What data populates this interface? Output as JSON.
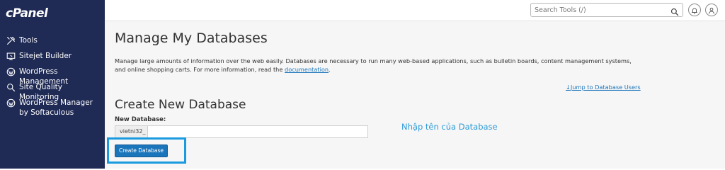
{
  "brand": {
    "logo_text": "cPanel"
  },
  "sidebar": {
    "items": [
      {
        "label": "Tools",
        "icon": "tools-icon"
      },
      {
        "label": "Sitejet Builder",
        "icon": "sitejet-icon"
      },
      {
        "label": "WordPress Management",
        "icon": "wordpress-icon"
      },
      {
        "label": "Site Quality Monitoring",
        "icon": "site-quality-icon"
      },
      {
        "label": "WordPress Manager by Softaculous",
        "icon": "wordpress-icon"
      }
    ]
  },
  "topbar": {
    "search_placeholder": "Search Tools (/)",
    "icons": [
      "search-icon",
      "bell-icon",
      "user-icon"
    ]
  },
  "page": {
    "title": "Manage My Databases",
    "description": "Manage large amounts of information over the web easily. Databases are necessary to run many web-based applications, such as bulletin boards, content management systems, and online shopping carts. For more information, read the",
    "documentation_link": "documentation",
    "description_end": ".",
    "jump_link": "Jump to Database Users"
  },
  "create_db": {
    "heading": "Create New Database",
    "field_label": "New Database:",
    "prefix": "vietni32_",
    "value": "",
    "button_label": "Create Database",
    "hint": "Nhập tên của Database"
  },
  "colors": {
    "sidebar_bg": "#1f2a55",
    "accent": "#1b75bb",
    "highlight": "#1a9be0",
    "hint_text": "#2d9bd8"
  }
}
